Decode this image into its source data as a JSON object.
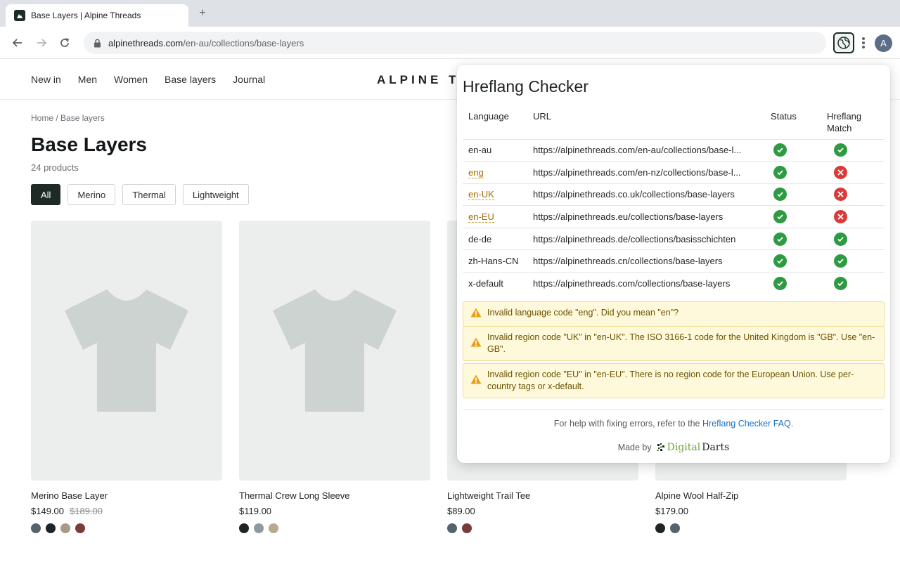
{
  "browser": {
    "tab_title": "Base Layers | Alpine Threads",
    "new_tab": "+",
    "url_host": "alpinethreads.com",
    "url_path": "/en-au/collections/base-layers",
    "avatar_letter": "A"
  },
  "site": {
    "nav": [
      "New in",
      "Men",
      "Women",
      "Base layers",
      "Journal"
    ],
    "brand": "ALPINE TH",
    "breadcrumb": "Home / Base layers",
    "title": "Base Layers",
    "count": "24 products",
    "filters": [
      {
        "label": "All",
        "active": true
      },
      {
        "label": "Merino",
        "active": false
      },
      {
        "label": "Thermal",
        "active": false
      },
      {
        "label": "Lightweight",
        "active": false
      }
    ],
    "products": [
      {
        "name": "Merino Base Layer",
        "price": "$149.00",
        "old_price": "$189.00",
        "swatches": [
          "#56636a",
          "#1f2524",
          "#a89a86",
          "#7a3b3b"
        ]
      },
      {
        "name": "Thermal Crew Long Sleeve",
        "price": "$119.00",
        "old_price": "",
        "swatches": [
          "#1f2524",
          "#8d9aa1",
          "#b9a890"
        ]
      },
      {
        "name": "Lightweight Trail Tee",
        "price": "$89.00",
        "old_price": "",
        "swatches": [
          "#56636a",
          "#7a3b3b"
        ]
      },
      {
        "name": "Alpine Wool Half-Zip",
        "price": "$179.00",
        "old_price": "",
        "swatches": [
          "#1f2524",
          "#56636a"
        ]
      }
    ]
  },
  "checker": {
    "title": "Hreflang Checker",
    "headers": {
      "language": "Language",
      "url": "URL",
      "status": "Status",
      "match": "Hreflang Match"
    },
    "rows": [
      {
        "lang": "en-au",
        "lang_error": false,
        "url": "https://alpinethreads.com/en-au/collections/base-l...",
        "status": "ok",
        "match": "ok"
      },
      {
        "lang": "eng",
        "lang_error": true,
        "url": "https://alpinethreads.com/en-nz/collections/base-l...",
        "status": "ok",
        "match": "error"
      },
      {
        "lang": "en-UK",
        "lang_error": true,
        "url": "https://alpinethreads.co.uk/collections/base-layers",
        "status": "ok",
        "match": "error"
      },
      {
        "lang": "en-EU",
        "lang_error": true,
        "url": "https://alpinethreads.eu/collections/base-layers",
        "status": "ok",
        "match": "error"
      },
      {
        "lang": "de-de",
        "lang_error": false,
        "url": "https://alpinethreads.de/collections/basisschichten",
        "status": "ok",
        "match": "ok"
      },
      {
        "lang": "zh-Hans-CN",
        "lang_error": false,
        "url": "https://alpinethreads.cn/collections/base-layers",
        "status": "ok",
        "match": "ok"
      },
      {
        "lang": "x-default",
        "lang_error": false,
        "url": "https://alpinethreads.com/collections/base-layers",
        "status": "ok",
        "match": "ok"
      }
    ],
    "warnings": [
      "Invalid language code \"eng\". Did you mean \"en\"?",
      "Invalid region code \"UK\" in \"en-UK\". The ISO 3166-1 code for the United Kingdom is \"GB\". Use \"en-GB\".",
      "Invalid region code \"EU\" in \"en-EU\". There is no region code for the European Union. Use per-country tags or x-default."
    ],
    "help_prefix": "For help with fixing errors, refer to the",
    "help_link": "Hreflang Checker FAQ",
    "help_suffix": ".",
    "made_by": "Made by",
    "logo_part1": "Digital",
    "logo_part2": "Darts"
  }
}
